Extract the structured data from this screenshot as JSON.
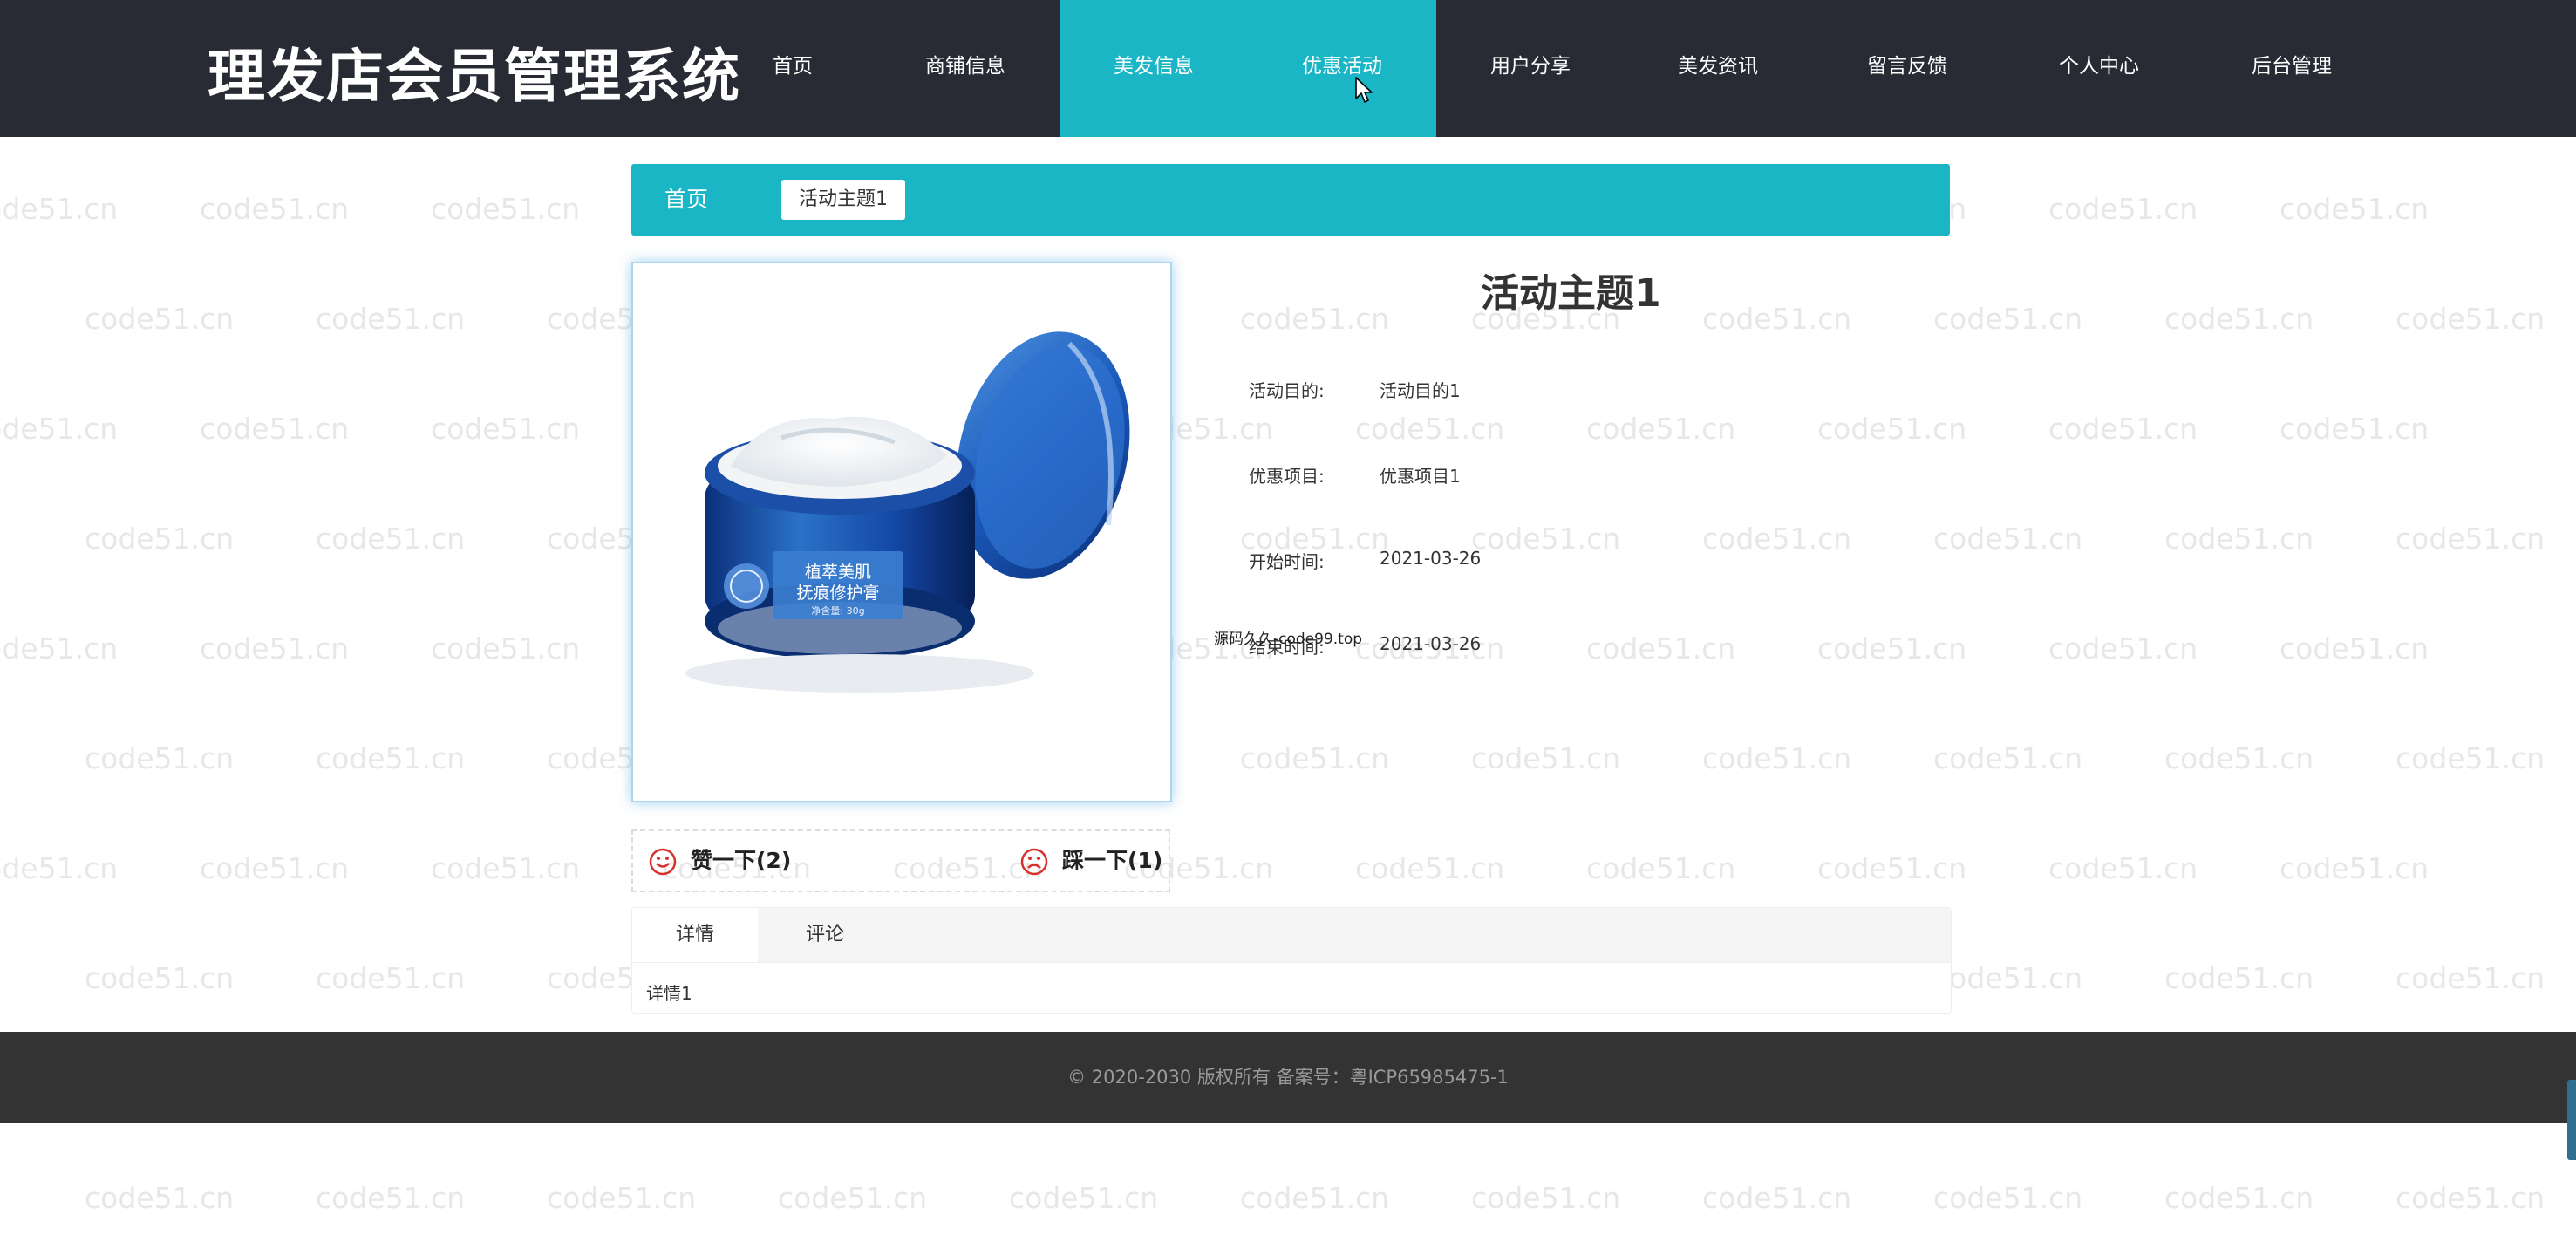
{
  "header": {
    "site_title": "理发店会员管理系统",
    "nav": [
      {
        "label": "首页"
      },
      {
        "label": "商铺信息"
      },
      {
        "label": "美发信息",
        "active": true
      },
      {
        "label": "优惠活动",
        "active": true
      },
      {
        "label": "用户分享"
      },
      {
        "label": "美发资讯"
      },
      {
        "label": "留言反馈"
      },
      {
        "label": "个人中心"
      },
      {
        "label": "后台管理"
      }
    ]
  },
  "breadcrumb": {
    "home": "首页",
    "current": "活动主题1"
  },
  "product": {
    "image_label_line1": "植萃美肌",
    "image_label_line2": "抚痕修护膏",
    "image_label_line3": "净含量: 30g",
    "title": "活动主题1",
    "fields": [
      {
        "label": "活动目的:",
        "value": "活动目的1"
      },
      {
        "label": "优惠项目:",
        "value": "优惠项目1"
      },
      {
        "label": "开始时间:",
        "value": "2021-03-26"
      },
      {
        "label": "结束时间:",
        "value": "2021-03-26"
      }
    ],
    "overlay_note": "源码久久-code99.top"
  },
  "votes": {
    "like": "赞一下(2)",
    "dislike": "踩一下(1)"
  },
  "tabs": {
    "items": [
      "详情",
      "评论"
    ],
    "active_index": 0,
    "content": "详情1"
  },
  "footer": {
    "text": "© 2020-2030 版权所有 备案号：粤ICP65985475-1"
  },
  "watermark": {
    "text": "code51.cn"
  },
  "colors": {
    "header_bg": "#282b34",
    "accent": "#1bb6c6",
    "footer_bg": "#333333"
  }
}
